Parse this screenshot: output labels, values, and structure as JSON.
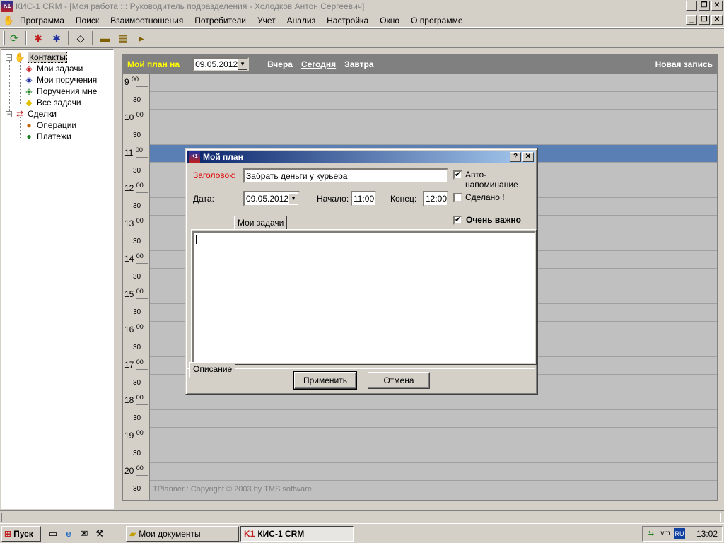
{
  "window": {
    "title": "КИС-1 CRM - [Моя работа ::: Руководитель подразделения - Холодков Антон Сергеевич]",
    "logo": "K1"
  },
  "menu": [
    "Программа",
    "Поиск",
    "Взаимоотношения",
    "Потребители",
    "Учет",
    "Анализ",
    "Настройка",
    "Окно",
    "О программе"
  ],
  "toolbar_icons": [
    "refresh-icon",
    "new-task-icon",
    "new-assignment-icon",
    "task-list-icon",
    "add-deal-icon",
    "add-operation-icon",
    "add-payment-icon"
  ],
  "tree": {
    "contacts": "Контакты",
    "my_tasks": "Мои задачи",
    "my_assignments": "Мои поручения",
    "assignments_to_me": "Поручения мне",
    "all_tasks": "Все задачи",
    "deals": "Сделки",
    "operations": "Операции",
    "payments": "Платежи"
  },
  "planner": {
    "plan_label": "Мой план на",
    "date": "09.05.2012",
    "yesterday": "Вчера",
    "today": "Сегодня",
    "tomorrow": "Завтра",
    "new_record": "Новая запись",
    "hours": [
      "9",
      "10",
      "11",
      "12",
      "13",
      "14",
      "15",
      "16",
      "17",
      "18",
      "19",
      "20"
    ],
    "minutes_top": "00",
    "minutes_half": "30",
    "selected_time": "11:00",
    "copyright": "TPlanner : Copyright © 2003 by TMS software"
  },
  "dialog": {
    "title": "Мой план",
    "logo": "K1",
    "subject_label": "Заголовок:",
    "subject_value": "Забрать деньги у курьера",
    "auto_reminder": "Авто-напоминание",
    "auto_reminder_checked": true,
    "date_label": "Дата:",
    "date_value": "09.05.2012",
    "start_label": "Начало:",
    "start_value": "11:00",
    "end_label": "Конец:",
    "end_value": "12:00",
    "done_label": "Сделано !",
    "done_checked": false,
    "important_label": "Очень важно",
    "important_checked": true,
    "tab_description": "Описание",
    "tab_my_tasks": "Мои задачи",
    "description_text": "",
    "apply": "Применить",
    "cancel": "Отмена"
  },
  "taskbar": {
    "start": "Пуск",
    "tasks": [
      "Мои документы",
      "КИС-1 CRM"
    ],
    "lang": "RU",
    "clock": "13:02"
  }
}
